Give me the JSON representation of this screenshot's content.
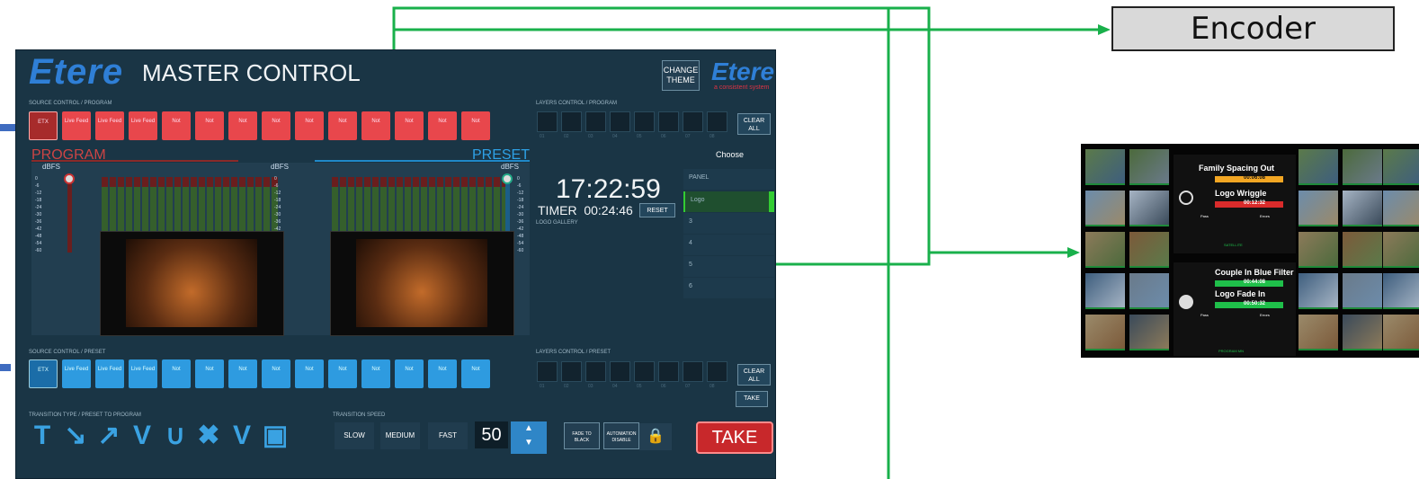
{
  "encoder": {
    "label": "Encoder"
  },
  "master_control": {
    "brand": "Etere",
    "title": "MASTER CONTROL",
    "change_theme": "CHANGE THEME",
    "brand_small": "Etere",
    "brand_tagline": "a consistent system",
    "source_program_label": "SOURCE CONTROL / PROGRAM",
    "source_preset_label": "SOURCE CONTROL / PRESET",
    "layers_program_label": "LAYERS CONTROL / PROGRAM",
    "layers_preset_label": "LAYERS CONTROL / PRESET",
    "clear_all": "CLEAR ALL",
    "program_sources": [
      "ETX",
      "Live Feed",
      "Live Feed",
      "Live Feed",
      "Not",
      "Not",
      "Not",
      "Not",
      "Not",
      "Not",
      "Not",
      "Not",
      "Not",
      "Not"
    ],
    "preset_sources": [
      "ETX",
      "Live Feed",
      "Live Feed",
      "Live Feed",
      "Not",
      "Not",
      "Not",
      "Not",
      "Not",
      "Not",
      "Not",
      "Not",
      "Not",
      "Not"
    ],
    "layer_numbers": [
      "01",
      "02",
      "03",
      "04",
      "05",
      "06",
      "07",
      "08"
    ],
    "program_label": "PROGRAM",
    "preset_label": "PRESET",
    "dbfs": "dBFS",
    "db_scale": [
      "0",
      "-6",
      "-12",
      "-18",
      "-24",
      "-30",
      "-36",
      "-42",
      "-48",
      "-54",
      "-60"
    ],
    "clock": "17:22:59",
    "timer_label": "TIMER",
    "timer_value": "00:24:46",
    "reset": "RESET",
    "logo_gallery": "LOGO GALLERY",
    "choose": "Choose",
    "panels": [
      "PANEL",
      "Logo",
      "3",
      "4",
      "5",
      "6"
    ],
    "transition_type_label": "TRANSITION TYPE / PRESET TO PROGRAM",
    "transition_speed_label": "TRANSITION SPEED",
    "transition_icons": [
      "T",
      "↘",
      "↗",
      "V",
      "∪",
      "✖",
      "V",
      "▣"
    ],
    "speeds": [
      "SLOW",
      "MEDIUM",
      "FAST"
    ],
    "speed_value": "50",
    "fade_to_black": "FADE TO BLACK",
    "automation_disable": "AUTOMATION DISABLE",
    "take": "TAKE",
    "take_small": "TAKE"
  },
  "multiviewer": {
    "top_title": "Family Spacing Out",
    "top_time": "00:06:08",
    "top_logo": "Logo Wriggle",
    "top_logo_time": "00:12:32",
    "pass": "Pass",
    "errors": "Errors",
    "satellite": "SATELLITE",
    "bottom_title": "Couple In Blue Filter",
    "bottom_time": "00:44:08",
    "bottom_logo": "Logo Fade In",
    "bottom_logo_time": "00:50:32",
    "program_label": "PROGRAM MN"
  },
  "colors": {
    "wire": "#19b04b",
    "program_red": "#e8474c",
    "preset_blue": "#2e9be0"
  }
}
